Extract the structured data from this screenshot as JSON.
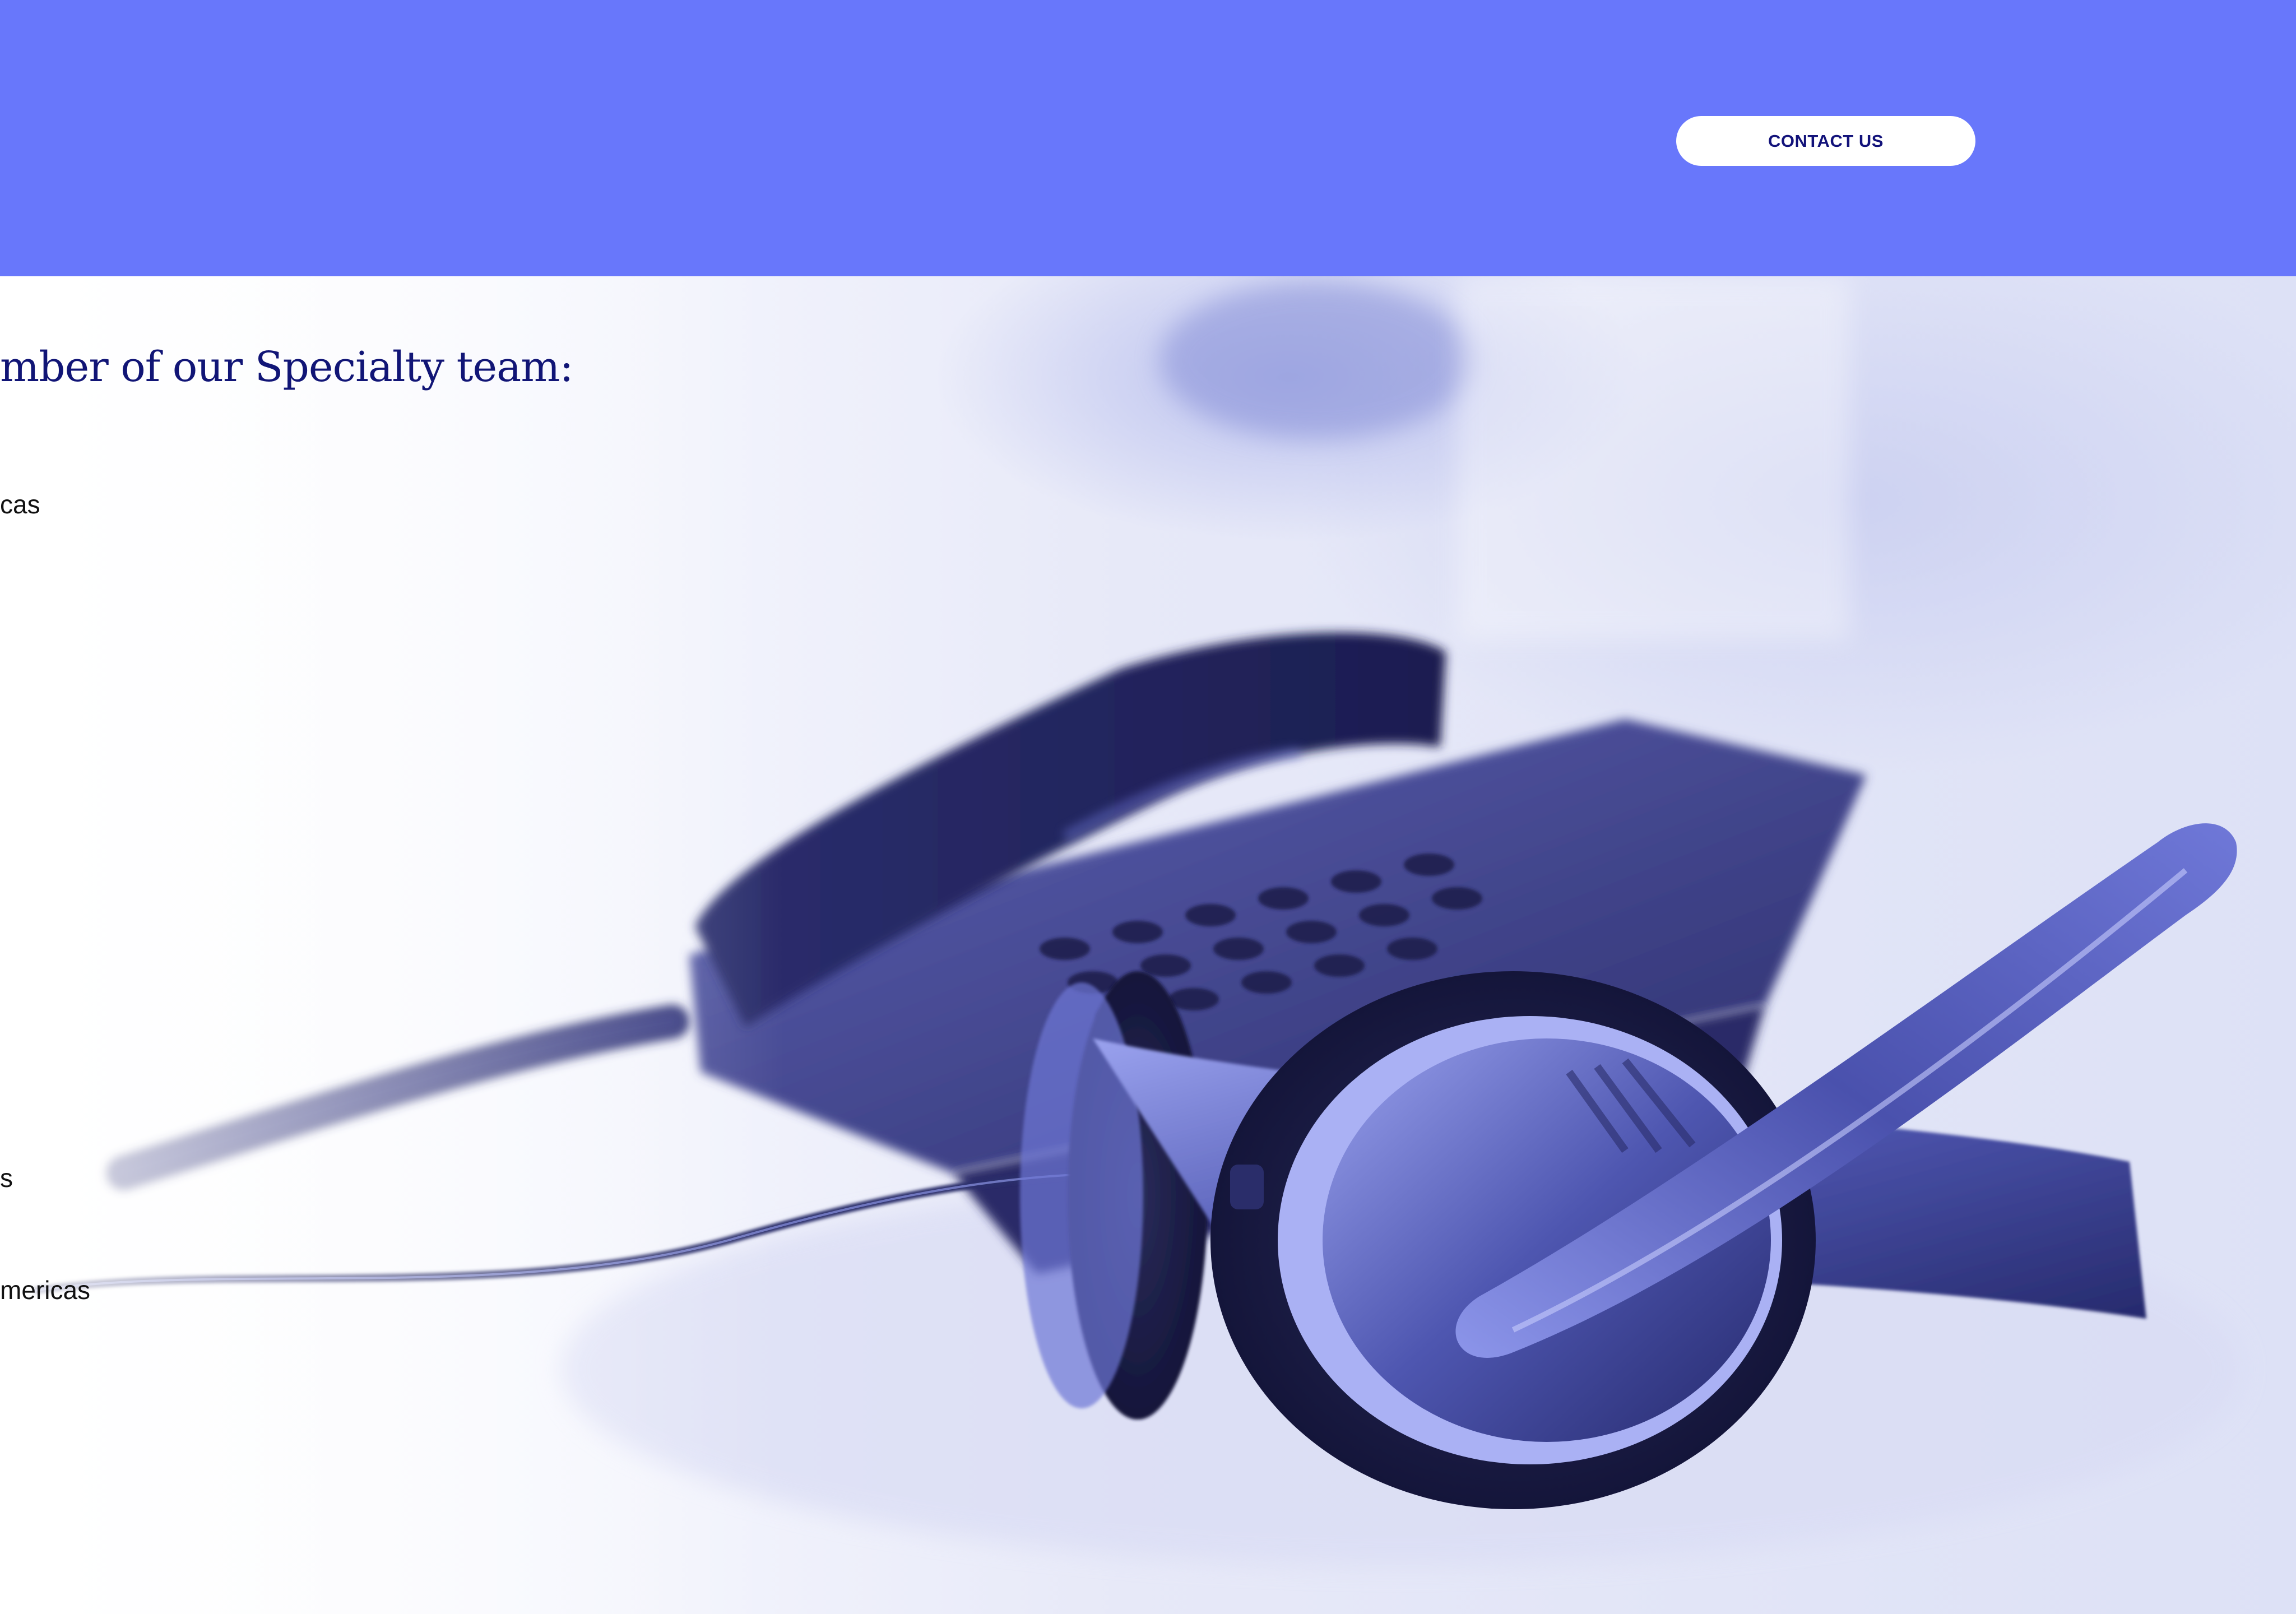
{
  "banner": {
    "background": "#6877fb",
    "contact_button_label": "CONTACT US"
  },
  "hero": {
    "image": "desk-phone-and-headset-photo",
    "heading": "mber of our Specialty team:",
    "region_texts": [
      "cas",
      "s",
      "mericas"
    ]
  },
  "colors": {
    "accent": "#6877fb",
    "heading": "#111576",
    "button_text": "#12127a"
  }
}
